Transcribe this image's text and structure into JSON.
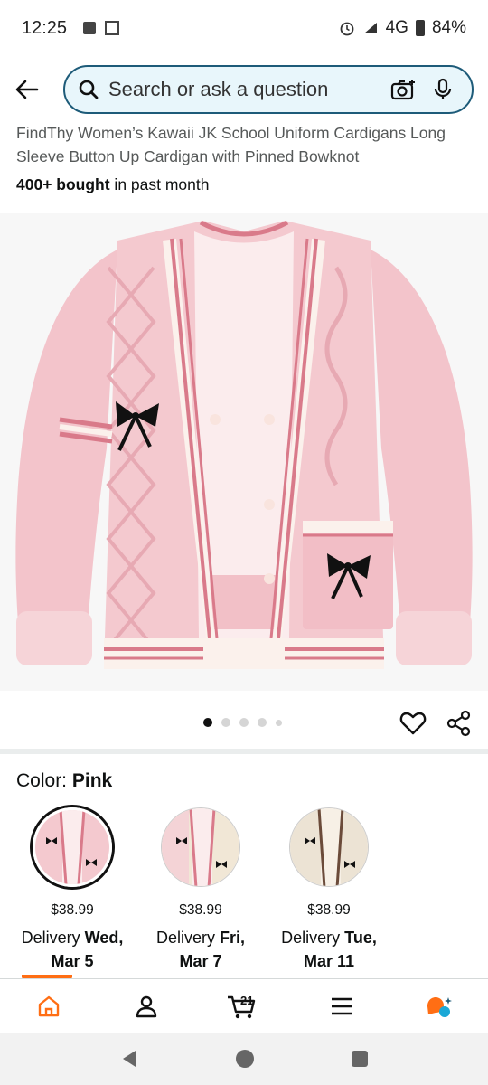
{
  "status_bar": {
    "time": "12:25",
    "network": "4G",
    "battery": "84%"
  },
  "search": {
    "placeholder": "Search or ask a question"
  },
  "product": {
    "title": "FindThy Women’s Kawaii JK School Uniform Cardigans Long Sleeve Button Up Cardigan with Pinned Bowknot",
    "bought_count": "400+ bought",
    "bought_suffix": " in past month"
  },
  "gallery": {
    "image_count": 5,
    "active_index": 0
  },
  "color": {
    "label": "Color: ",
    "selected": "Pink"
  },
  "variants": [
    {
      "price": "$38.99",
      "delivery_prefix": "Delivery ",
      "day": "Wed,",
      "date": "Mar 5",
      "colors": {
        "base": "#f4c9cf",
        "trim": "#d97a8a"
      }
    },
    {
      "price": "$38.99",
      "delivery_prefix": "Delivery ",
      "day": "Fri,",
      "date": "Mar 7",
      "colors": {
        "base": "#f1e7d6",
        "trim": "#d97a8a"
      }
    },
    {
      "price": "$38.99",
      "delivery_prefix": "Delivery ",
      "day": "Tue,",
      "date": "Mar 11",
      "colors": {
        "base": "#ece3d4",
        "trim": "#6b4b3a"
      }
    }
  ],
  "nav": {
    "cart_count": "21",
    "items": [
      "home-icon",
      "account-icon",
      "cart-icon",
      "menu-icon",
      "rufus-icon"
    ]
  },
  "theme": {
    "accent": "#ff6e14",
    "search_border": "#1d5b79",
    "search_bg": "#e8f6fb",
    "sweater_pink": "#f4c9cf",
    "stripe_red": "#d97a8a"
  }
}
